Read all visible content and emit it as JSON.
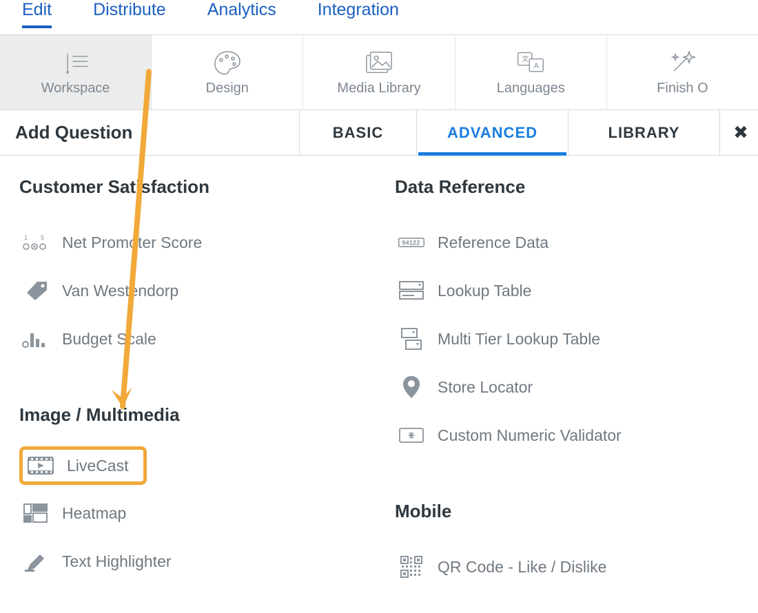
{
  "topnav": {
    "items": [
      {
        "label": "Edit",
        "active": true
      },
      {
        "label": "Distribute",
        "active": false
      },
      {
        "label": "Analytics",
        "active": false
      },
      {
        "label": "Integration",
        "active": false
      }
    ]
  },
  "toolbar": {
    "items": [
      {
        "label": "Workspace",
        "icon": "workspace-icon",
        "active": true
      },
      {
        "label": "Design",
        "icon": "palette-icon",
        "active": false
      },
      {
        "label": "Media Library",
        "icon": "image-icon",
        "active": false
      },
      {
        "label": "Languages",
        "icon": "translate-icon",
        "active": false
      },
      {
        "label": "Finish O",
        "icon": "wand-icon",
        "active": false
      }
    ]
  },
  "tabrow": {
    "title": "Add Question",
    "tabs": [
      {
        "label": "BASIC",
        "active": false
      },
      {
        "label": "ADVANCED",
        "active": true
      },
      {
        "label": "LIBRARY",
        "active": false
      }
    ]
  },
  "columns": {
    "left": {
      "cat1": {
        "heading": "Customer Satisfaction",
        "items": [
          {
            "label": "Net Promoter Score",
            "icon": "nps-icon"
          },
          {
            "label": "Van Westendorp",
            "icon": "tag-icon"
          },
          {
            "label": "Budget Scale",
            "icon": "bars-icon"
          }
        ]
      },
      "cat2": {
        "heading": "Image / Multimedia",
        "items": [
          {
            "label": "LiveCast",
            "icon": "film-icon",
            "highlighted": true
          },
          {
            "label": "Heatmap",
            "icon": "heatmap-icon"
          },
          {
            "label": "Text Highlighter",
            "icon": "highlighter-icon"
          }
        ]
      }
    },
    "right": {
      "cat1": {
        "heading": "Data Reference",
        "items": [
          {
            "label": "Reference Data",
            "icon": "zip-icon"
          },
          {
            "label": "Lookup Table",
            "icon": "lookup-icon"
          },
          {
            "label": "Multi Tier Lookup Table",
            "icon": "multitier-icon"
          },
          {
            "label": "Store Locator",
            "icon": "pin-icon"
          },
          {
            "label": "Custom Numeric Validator",
            "icon": "numeric-icon"
          }
        ]
      },
      "cat2": {
        "heading": "Mobile",
        "items": [
          {
            "label": "QR Code - Like / Dislike",
            "icon": "qr-icon"
          }
        ]
      }
    }
  },
  "colors": {
    "accent": "#1a7de0",
    "link": "#1a5fbf",
    "highlight": "#f1a939",
    "text": "#2f383f",
    "muted": "#6f7880"
  }
}
